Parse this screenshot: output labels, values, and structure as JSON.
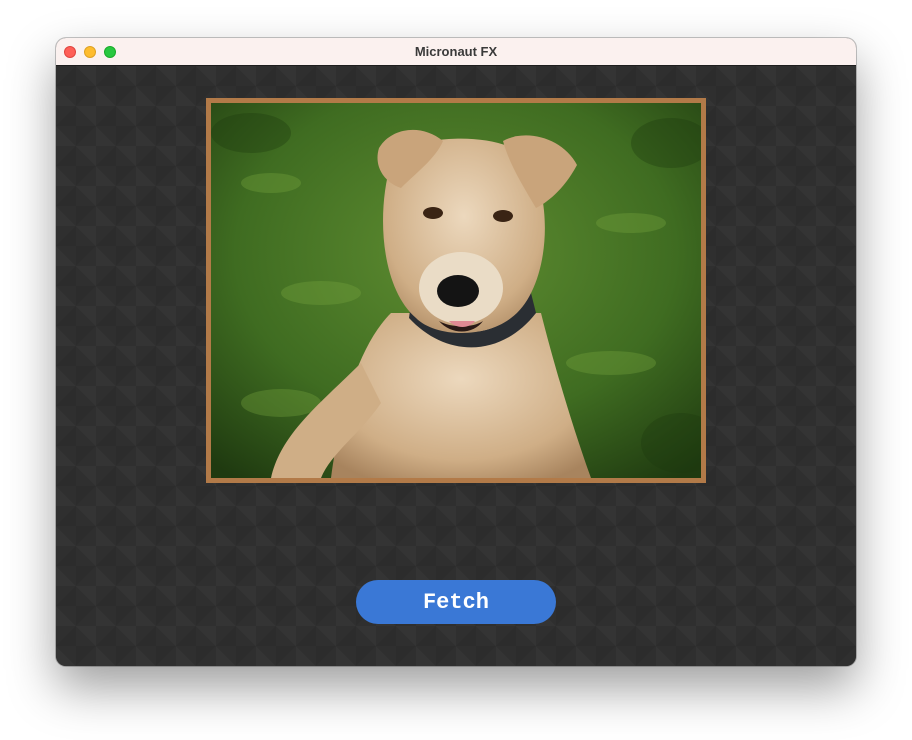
{
  "window": {
    "title": "Micronaut FX",
    "controls": [
      "close",
      "minimize",
      "zoom"
    ]
  },
  "main": {
    "image": {
      "subject": "dog-photo",
      "frame_color": "#b27a48"
    },
    "fetch_button": {
      "label": "Fetch",
      "color": "#3a78d6"
    }
  },
  "colors": {
    "background": "#2f2f2f",
    "titlebar": "#fbf1ef",
    "close": "#fe5f57",
    "minimize": "#febc2e",
    "zoom": "#28c840"
  }
}
